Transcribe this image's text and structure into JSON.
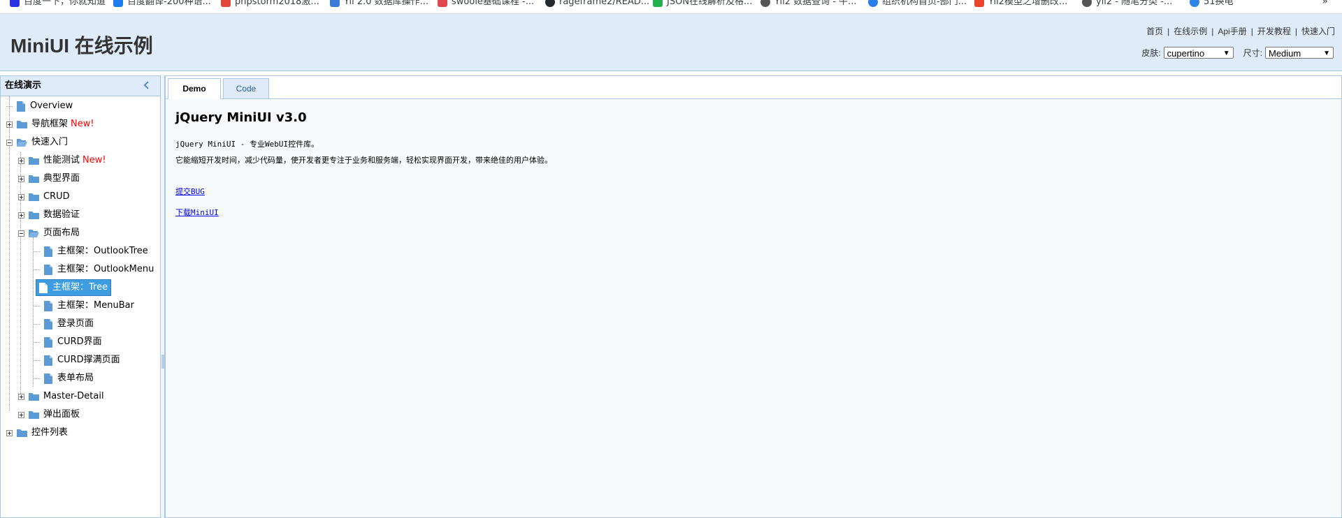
{
  "bookmarks": [
    {
      "label": "百度一下，你就知道",
      "color": "#2932e1"
    },
    {
      "label": "百度翻译-200种语...",
      "color": "#1e7bf0"
    },
    {
      "label": "phpstorm2018激...",
      "color": "#e2453c"
    },
    {
      "label": "Yii 2.0 数据库操作...",
      "color": "#3a7bd5"
    },
    {
      "label": "swoole基础课程 -...",
      "color": "#e0484f"
    },
    {
      "label": "rageframe2/READ...",
      "color": "#24292e"
    },
    {
      "label": "JSON在线解析及格...",
      "color": "#22b14c"
    },
    {
      "label": "Yii2 数据查询 - 牛...",
      "color": "#555555"
    },
    {
      "label": "组织机构首页-部门...",
      "color": "#2b7de9"
    },
    {
      "label": "Yii2模型之增删改...",
      "color": "#e8452d"
    },
    {
      "label": "yii2 - 随笔分类 -...",
      "color": "#555555"
    },
    {
      "label": "51换电",
      "color": "#2b85e4"
    }
  ],
  "bookmarks_more": "»",
  "header": {
    "title": "MiniUI 在线示例",
    "links": [
      "首页",
      "在线示例",
      "Api手册",
      "开发教程",
      "快速入门"
    ],
    "separator": "|",
    "skin_label": "皮肤:",
    "skin_value": "cupertino",
    "size_label": "尺寸:",
    "size_value": "Medium"
  },
  "sidebar": {
    "title": "在线演示",
    "nodes": [
      {
        "label": "Overview",
        "new": ""
      },
      {
        "label": "导航框架",
        "new": "New!"
      },
      {
        "label": "快速入门",
        "new": ""
      },
      {
        "label": "性能测试",
        "new": "New!"
      },
      {
        "label": "典型界面",
        "new": ""
      },
      {
        "label": "CRUD",
        "new": ""
      },
      {
        "label": "数据验证",
        "new": ""
      },
      {
        "label": "页面布局",
        "new": ""
      },
      {
        "label": "主框架：OutlookTree",
        "new": ""
      },
      {
        "label": "主框架：OutlookMenu",
        "new": ""
      },
      {
        "label": "主框架：Tree",
        "new": ""
      },
      {
        "label": "主框架：MenuBar",
        "new": ""
      },
      {
        "label": "登录页面",
        "new": ""
      },
      {
        "label": "CURD界面",
        "new": ""
      },
      {
        "label": "CURD撑满页面",
        "new": ""
      },
      {
        "label": "表单布局",
        "new": ""
      },
      {
        "label": "Master-Detail",
        "new": ""
      },
      {
        "label": "弹出面板",
        "new": ""
      },
      {
        "label": "控件列表",
        "new": ""
      }
    ]
  },
  "tabs": [
    {
      "label": "Demo",
      "active": true
    },
    {
      "label": "Code",
      "active": false
    }
  ],
  "content": {
    "heading": "jQuery MiniUI v3.0",
    "line1": "jQuery MiniUI - 专业WebUI控件库。",
    "line2": "它能缩短开发时间，减少代码量，使开发者更专注于业务和服务端，轻松实现界面开发，带来绝佳的用户体验。",
    "link1": "提交BUG",
    "link2": "下载MiniUI"
  },
  "colors": {
    "header_bg": "#dfebf8",
    "border": "#a8c6e8",
    "selected": "#3d9de0",
    "new_badge": "#ff0000"
  }
}
